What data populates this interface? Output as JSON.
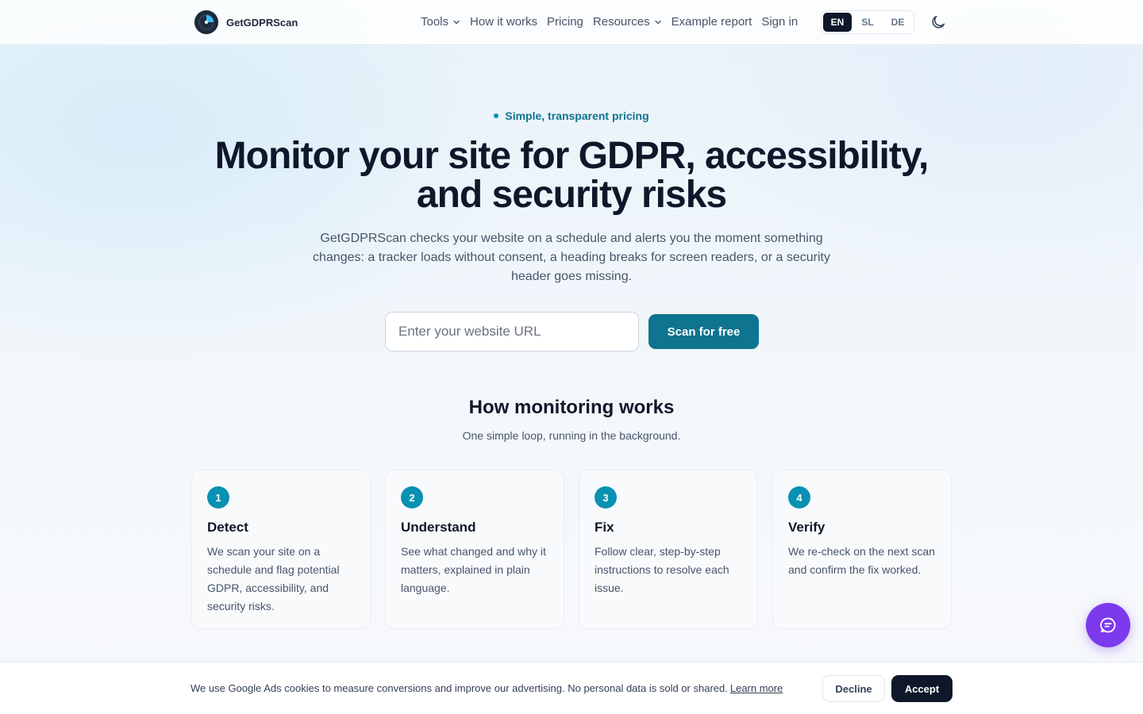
{
  "nav": {
    "brand": "GetGDPRScan",
    "links": [
      {
        "label": "Tools",
        "dropdown": true
      },
      {
        "label": "How it works",
        "dropdown": false
      },
      {
        "label": "Pricing",
        "dropdown": false
      },
      {
        "label": "Resources",
        "dropdown": true
      },
      {
        "label": "Example report",
        "dropdown": false
      },
      {
        "label": "Sign in",
        "dropdown": false
      }
    ],
    "languages": [
      "EN",
      "SL",
      "DE"
    ],
    "active_language": "EN"
  },
  "hero": {
    "badge": "Simple, transparent pricing",
    "headline_line1": "Monitor your site for GDPR, accessibility,",
    "headline_line2": "and security risks",
    "subtitle": "GetGDPRScan checks your website on a schedule and alerts you the moment something changes: a tracker loads without consent, a heading breaks for screen readers, or a security header goes missing.",
    "url_placeholder": "Enter your website URL",
    "url_value": "",
    "scan_button": "Scan for free"
  },
  "how": {
    "title": "How monitoring works",
    "subtitle": "One simple loop, running in the background.",
    "steps": [
      {
        "number": "1",
        "title": "Detect",
        "text": "We scan your site on a schedule and flag potential GDPR, accessibility, and security risks."
      },
      {
        "number": "2",
        "title": "Understand",
        "text": "See what changed and why it matters, explained in plain language."
      },
      {
        "number": "3",
        "title": "Fix",
        "text": "Follow clear, step-by-step instructions to resolve each issue."
      },
      {
        "number": "4",
        "title": "Verify",
        "text": "We re-check on the next scan and confirm the fix worked."
      }
    ]
  },
  "cookie": {
    "text": "We use Google Ads cookies to measure conversions and improve our advertising. No personal data is sold or shared.",
    "link": "Learn more",
    "decline": "Decline",
    "accept": "Accept"
  },
  "icons": {
    "theme": "moon-icon",
    "chat": "chat-icon",
    "dropdown": "chevron-down-icon"
  },
  "colors": {
    "accent": "#0e7490",
    "step_badge": "#0891b2",
    "chat_button": "#7c3aed",
    "dark": "#0f172a"
  }
}
